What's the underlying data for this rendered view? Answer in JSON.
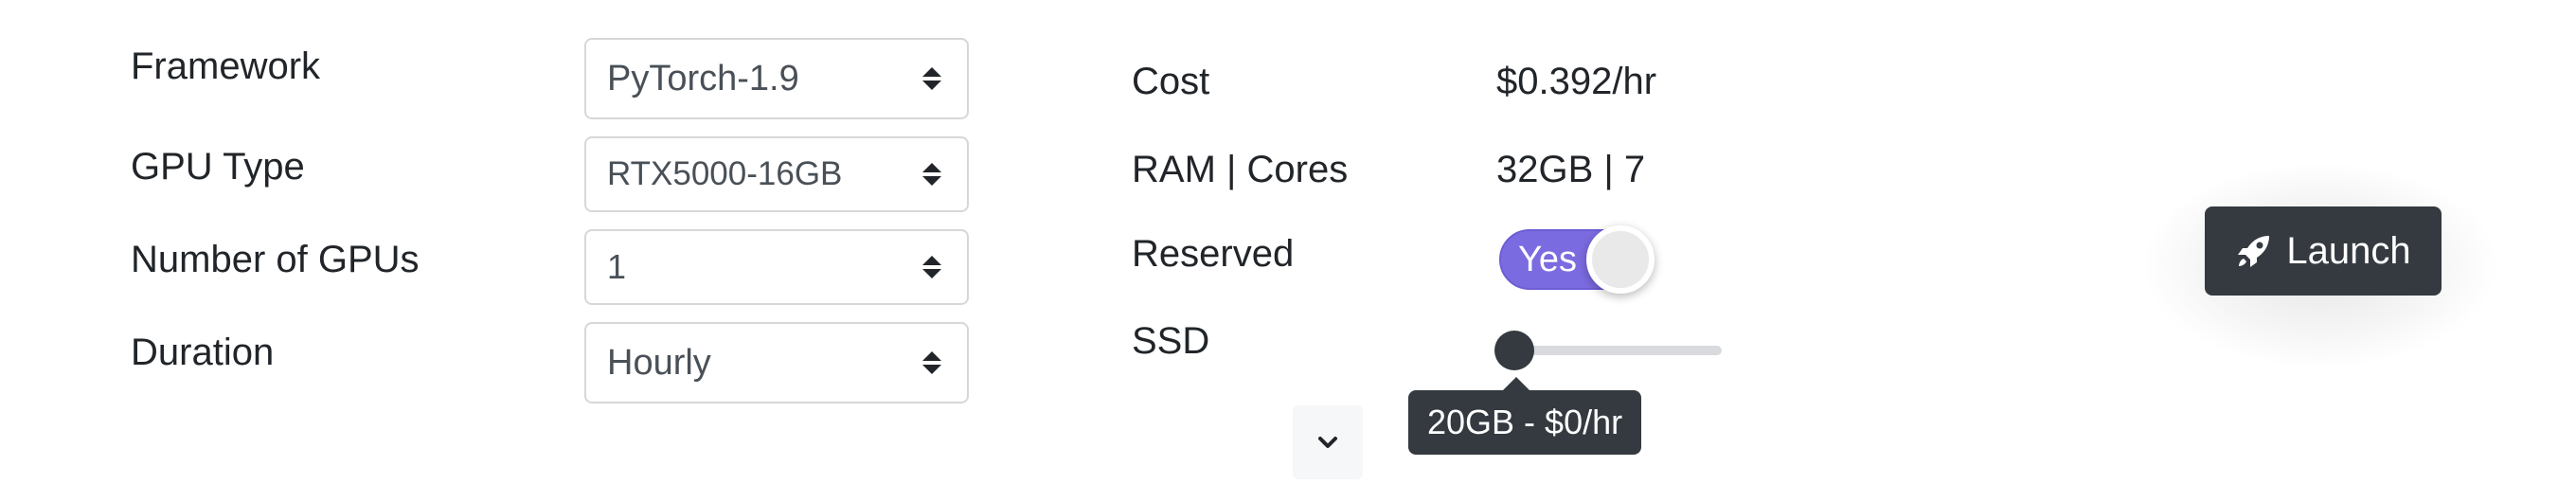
{
  "form": {
    "framework": {
      "label": "Framework",
      "value": "PyTorch-1.9"
    },
    "gpu_type": {
      "label": "GPU Type",
      "value": "RTX5000-16GB"
    },
    "num_gpus": {
      "label": "Number of GPUs",
      "value": "1"
    },
    "duration": {
      "label": "Duration",
      "value": "Hourly"
    }
  },
  "summary": {
    "cost": {
      "label": "Cost",
      "value": "$0.392/hr"
    },
    "ram_cores": {
      "label": "RAM | Cores",
      "value": "32GB | 7"
    },
    "reserved": {
      "label": "Reserved",
      "toggle_text": "Yes",
      "on": true
    },
    "ssd": {
      "label": "SSD",
      "tooltip": "20GB - $0/hr",
      "level": 0
    }
  },
  "actions": {
    "launch_label": "Launch",
    "expand_icon": "chevron-down-icon",
    "launch_icon": "rocket-icon"
  },
  "colors": {
    "toggle_on": "#7b6be0",
    "dark": "#343a40"
  }
}
